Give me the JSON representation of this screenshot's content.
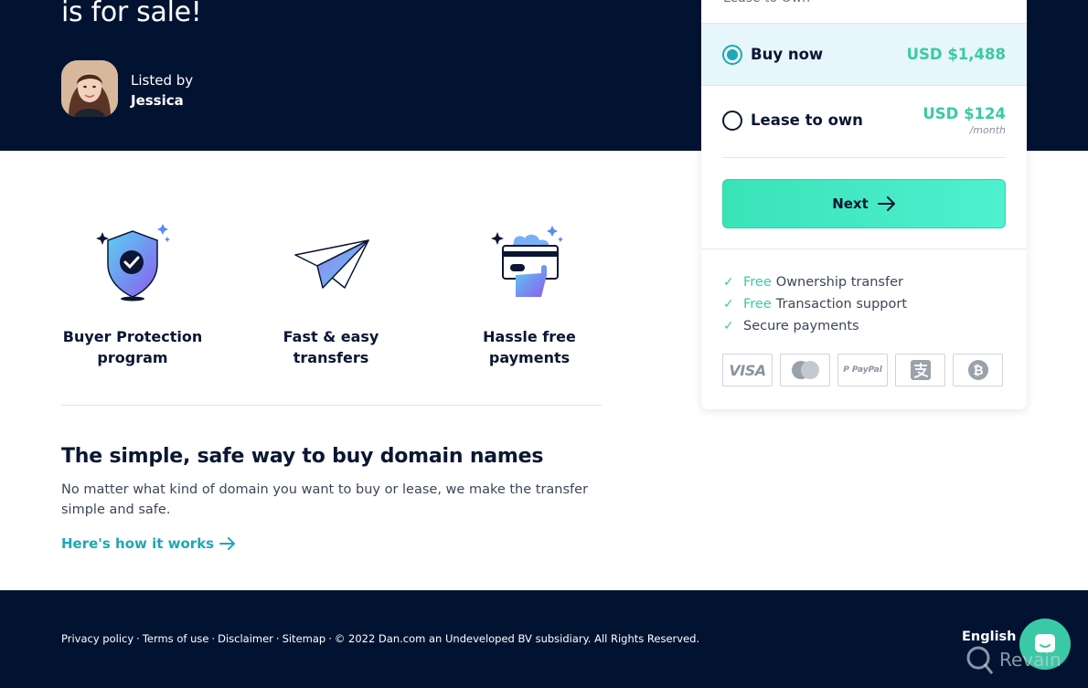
{
  "hero": {
    "title": "is for sale!",
    "listed_by_label": "Listed by",
    "seller_name": "Jessica"
  },
  "features": [
    {
      "icon": "shield-check-icon",
      "label_line1": "Buyer Protection",
      "label_line2": "program"
    },
    {
      "icon": "paper-plane-icon",
      "label_line1": "Fast & easy",
      "label_line2": "transfers"
    },
    {
      "icon": "card-payment-icon",
      "label_line1": "Hassle free",
      "label_line2": "payments"
    }
  ],
  "info": {
    "heading": "The simple, safe way to buy domain names",
    "description": "No matter what kind of domain you want to buy or lease, we make the transfer simple and safe.",
    "link": "Here's how it works"
  },
  "purchase_card": {
    "previous_option_partial": "Lease to Own",
    "options": [
      {
        "label": "Buy now",
        "price": "USD $1,488",
        "sub": "",
        "selected": true
      },
      {
        "label": "Lease to own",
        "price": "USD $124",
        "sub": "/month",
        "selected": false
      }
    ],
    "next_button": "Next",
    "benefits": [
      {
        "free": "Free",
        "text": "Ownership transfer"
      },
      {
        "free": "Free",
        "text": "Transaction support"
      },
      {
        "free": "",
        "text": "Secure payments"
      }
    ],
    "payment_methods": [
      {
        "name": "visa",
        "label": "VISA"
      },
      {
        "name": "mastercard",
        "label": ""
      },
      {
        "name": "paypal",
        "label": "PayPal"
      },
      {
        "name": "alipay",
        "label": ""
      },
      {
        "name": "bitcoin",
        "label": ""
      }
    ],
    "colors": {
      "accent": "#3ac9a6",
      "teal": "#1fa7b5",
      "navy": "#021332"
    }
  },
  "footer": {
    "links": [
      "Privacy policy",
      "Terms of use",
      "Disclaimer",
      "Sitemap"
    ],
    "copyright": "© 2022 Dan.com an Undeveloped BV subsidiary. All Rights Reserved.",
    "language": "English"
  },
  "watermark": "Revain"
}
